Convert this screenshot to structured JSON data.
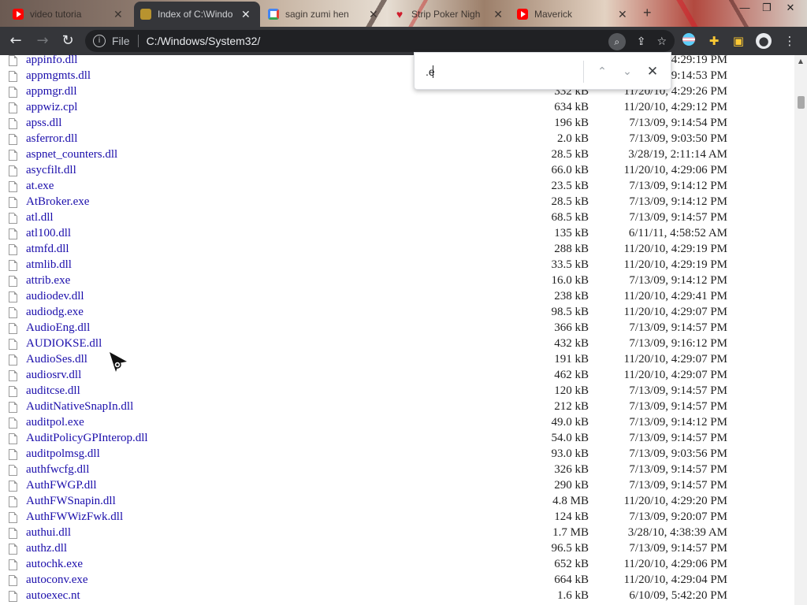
{
  "tabs": [
    {
      "title": "video tutoria",
      "icon": "youtube-icon",
      "active": false
    },
    {
      "title": "Index of C:\\Windo",
      "icon": "folder-shell-icon",
      "active": true
    },
    {
      "title": "sagin  zumi hen",
      "icon": "google-icon",
      "active": false
    },
    {
      "title": "Strip Poker Nigh",
      "icon": "heart-icon",
      "active": false
    },
    {
      "title": "Maverick",
      "icon": "youtube-icon",
      "active": false
    }
  ],
  "toolbar": {
    "scheme": "File",
    "url": "C:/Windows/System32/"
  },
  "find": {
    "query": ".e"
  },
  "files": [
    {
      "name": "appinfo.dll",
      "size": "",
      "date": "4:29:19 PM"
    },
    {
      "name": "appmgmts.dll",
      "size": "",
      "date": "9:14:53 PM"
    },
    {
      "name": "appmgr.dll",
      "size": "332 kB",
      "date": "11/20/10, 4:29:26 PM"
    },
    {
      "name": "appwiz.cpl",
      "size": "634 kB",
      "date": "11/20/10, 4:29:12 PM"
    },
    {
      "name": "apss.dll",
      "size": "196 kB",
      "date": "7/13/09, 9:14:54 PM"
    },
    {
      "name": "asferror.dll",
      "size": "2.0 kB",
      "date": "7/13/09, 9:03:50 PM"
    },
    {
      "name": "aspnet_counters.dll",
      "size": "28.5 kB",
      "date": "3/28/19, 2:11:14 AM"
    },
    {
      "name": "asycfilt.dll",
      "size": "66.0 kB",
      "date": "11/20/10, 4:29:06 PM"
    },
    {
      "name": "at.exe",
      "size": "23.5 kB",
      "date": "7/13/09, 9:14:12 PM"
    },
    {
      "name": "AtBroker.exe",
      "size": "28.5 kB",
      "date": "7/13/09, 9:14:12 PM"
    },
    {
      "name": "atl.dll",
      "size": "68.5 kB",
      "date": "7/13/09, 9:14:57 PM"
    },
    {
      "name": "atl100.dll",
      "size": "135 kB",
      "date": "6/11/11, 4:58:52 AM"
    },
    {
      "name": "atmfd.dll",
      "size": "288 kB",
      "date": "11/20/10, 4:29:19 PM"
    },
    {
      "name": "atmlib.dll",
      "size": "33.5 kB",
      "date": "11/20/10, 4:29:19 PM"
    },
    {
      "name": "attrib.exe",
      "size": "16.0 kB",
      "date": "7/13/09, 9:14:12 PM"
    },
    {
      "name": "audiodev.dll",
      "size": "238 kB",
      "date": "11/20/10, 4:29:41 PM"
    },
    {
      "name": "audiodg.exe",
      "size": "98.5 kB",
      "date": "11/20/10, 4:29:07 PM"
    },
    {
      "name": "AudioEng.dll",
      "size": "366 kB",
      "date": "7/13/09, 9:14:57 PM"
    },
    {
      "name": "AUDIOKSE.dll",
      "size": "432 kB",
      "date": "7/13/09, 9:16:12 PM"
    },
    {
      "name": "AudioSes.dll",
      "size": "191 kB",
      "date": "11/20/10, 4:29:07 PM"
    },
    {
      "name": "audiosrv.dll",
      "size": "462 kB",
      "date": "11/20/10, 4:29:07 PM"
    },
    {
      "name": "auditcse.dll",
      "size": "120 kB",
      "date": "7/13/09, 9:14:57 PM"
    },
    {
      "name": "AuditNativeSnapIn.dll",
      "size": "212 kB",
      "date": "7/13/09, 9:14:57 PM"
    },
    {
      "name": "auditpol.exe",
      "size": "49.0 kB",
      "date": "7/13/09, 9:14:12 PM"
    },
    {
      "name": "AuditPolicyGPInterop.dll",
      "size": "54.0 kB",
      "date": "7/13/09, 9:14:57 PM"
    },
    {
      "name": "auditpolmsg.dll",
      "size": "93.0 kB",
      "date": "7/13/09, 9:03:56 PM"
    },
    {
      "name": "authfwcfg.dll",
      "size": "326 kB",
      "date": "7/13/09, 9:14:57 PM"
    },
    {
      "name": "AuthFWGP.dll",
      "size": "290 kB",
      "date": "7/13/09, 9:14:57 PM"
    },
    {
      "name": "AuthFWSnapin.dll",
      "size": "4.8 MB",
      "date": "11/20/10, 4:29:20 PM"
    },
    {
      "name": "AuthFWWizFwk.dll",
      "size": "124 kB",
      "date": "7/13/09, 9:20:07 PM"
    },
    {
      "name": "authui.dll",
      "size": "1.7 MB",
      "date": "3/28/10, 4:38:39 AM"
    },
    {
      "name": "authz.dll",
      "size": "96.5 kB",
      "date": "7/13/09, 9:14:57 PM"
    },
    {
      "name": "autochk.exe",
      "size": "652 kB",
      "date": "11/20/10, 4:29:06 PM"
    },
    {
      "name": "autoconv.exe",
      "size": "664 kB",
      "date": "11/20/10, 4:29:04 PM"
    },
    {
      "name": "autoexec.nt",
      "size": "1.6 kB",
      "date": "6/10/09, 5:42:20 PM"
    }
  ]
}
